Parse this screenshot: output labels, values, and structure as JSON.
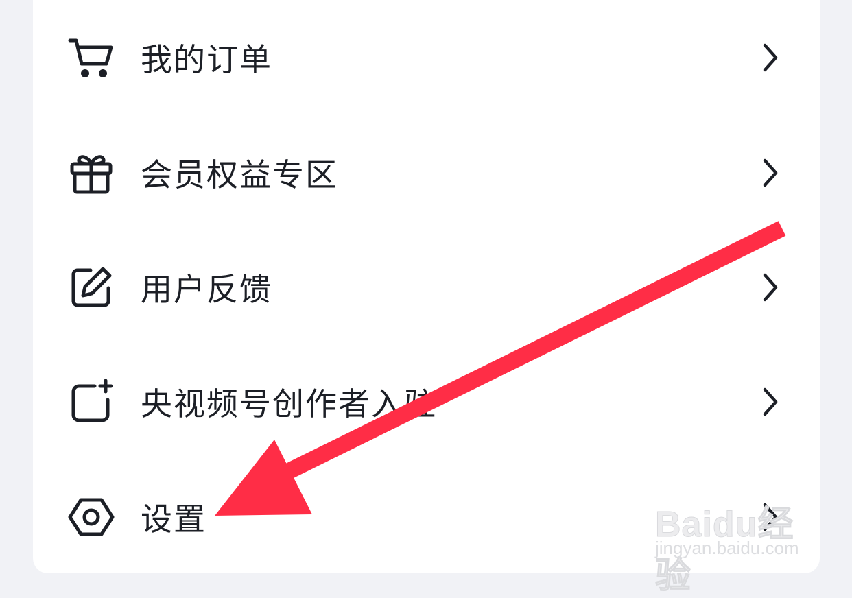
{
  "menu": {
    "items": [
      {
        "label": "我的订单",
        "icon": "cart-icon"
      },
      {
        "label": "会员权益专区",
        "icon": "gift-icon"
      },
      {
        "label": "用户反馈",
        "icon": "edit-icon"
      },
      {
        "label": "央视频号创作者入驻",
        "icon": "add-square-icon"
      },
      {
        "label": "设置",
        "icon": "settings-hexagon-icon"
      }
    ]
  },
  "annotation": {
    "arrow_color": "#ff2d46"
  },
  "watermark": {
    "main": "Baidu经验",
    "sub": "jingyan.baidu.com"
  },
  "colors": {
    "text": "#1c1f26",
    "card": "#ffffff",
    "background": "#f1f2f6"
  }
}
